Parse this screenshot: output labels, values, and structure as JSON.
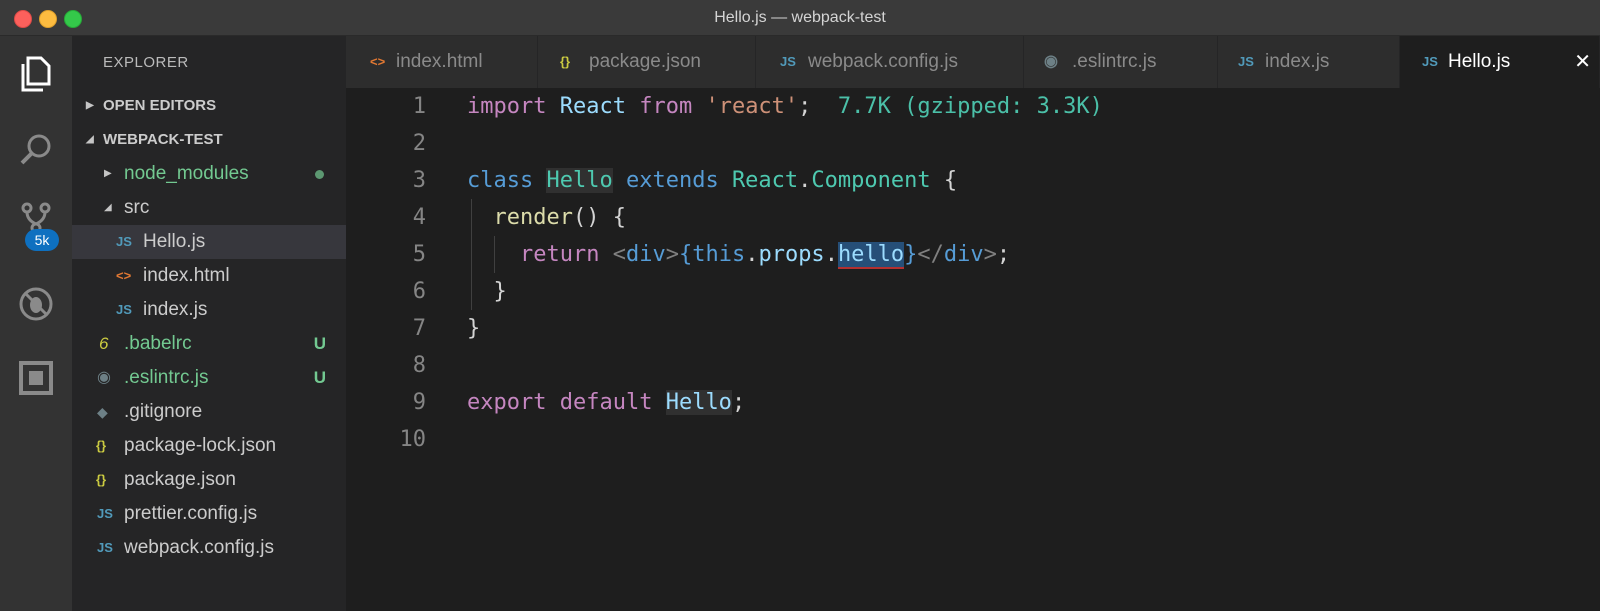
{
  "window": {
    "title": "Hello.js — webpack-test"
  },
  "activity": {
    "badge": "5k"
  },
  "explorer": {
    "title": "EXPLORER",
    "open_editors_label": "OPEN EDITORS",
    "project_label": "WEBPACK-TEST"
  },
  "tree": [
    {
      "name": "node_modules",
      "icon": "folder-arrow-icon",
      "status": ""
    },
    {
      "name": "src",
      "icon": "folder-open-arrow-icon",
      "status": ""
    },
    {
      "name": "Hello.js",
      "icon": "js-icon",
      "icon_text": "JS",
      "status": ""
    },
    {
      "name": "index.html",
      "icon": "html-icon",
      "icon_text": "<>",
      "status": ""
    },
    {
      "name": "index.js",
      "icon": "js-icon",
      "icon_text": "JS",
      "status": ""
    },
    {
      "name": ".babelrc",
      "icon": "babel-icon",
      "icon_text": "6",
      "status": "U"
    },
    {
      "name": ".eslintrc.js",
      "icon": "gear-icon",
      "icon_text": "◉",
      "status": "U"
    },
    {
      "name": ".gitignore",
      "icon": "git-icon",
      "icon_text": "◆",
      "status": ""
    },
    {
      "name": "package-lock.json",
      "icon": "json-icon",
      "icon_text": "{}",
      "status": ""
    },
    {
      "name": "package.json",
      "icon": "json-icon",
      "icon_text": "{}",
      "status": ""
    },
    {
      "name": "prettier.config.js",
      "icon": "js-icon",
      "icon_text": "JS",
      "status": ""
    },
    {
      "name": "webpack.config.js",
      "icon": "js-icon",
      "icon_text": "JS",
      "status": ""
    }
  ],
  "tabs": [
    {
      "label": "index.html",
      "icon_text": "<>"
    },
    {
      "label": "package.json",
      "icon_text": "{}"
    },
    {
      "label": "webpack.config.js",
      "icon_text": "JS"
    },
    {
      "label": ".eslintrc.js",
      "icon_text": "◉"
    },
    {
      "label": "index.js",
      "icon_text": "JS"
    },
    {
      "label": "Hello.js",
      "icon_text": "JS",
      "close": "✕"
    }
  ],
  "editor": {
    "line_numbers": [
      "1",
      "2",
      "3",
      "4",
      "5",
      "6",
      "7",
      "8",
      "9",
      "10"
    ],
    "l1": {
      "import": "import",
      "react": "React",
      "from": "from",
      "str": "'react'",
      "semi": ";",
      "hint": "7.7K (gzipped: 3.3K)"
    },
    "l3": {
      "class": "class",
      "name": "Hello",
      "extends": "extends",
      "react": "React",
      "dot": ".",
      "component": "Component",
      "brace": "{"
    },
    "l4": {
      "render": "render",
      "rest": "() {"
    },
    "l5": {
      "return": "return",
      "lt": "<",
      "div": "div",
      "gt": ">",
      "ob": "{",
      "this": "this",
      "dot1": ".",
      "props": "props",
      "dot2": ".",
      "hello": "hello",
      "cb": "}",
      "close_open": "</",
      "div2": "div",
      "close_end": ">",
      "semi": ";"
    },
    "l6": {
      "brace": "}"
    },
    "l7": {
      "brace": "}"
    },
    "l9": {
      "export": "export",
      "default": "default",
      "name": "Hello",
      "semi": ";"
    }
  }
}
